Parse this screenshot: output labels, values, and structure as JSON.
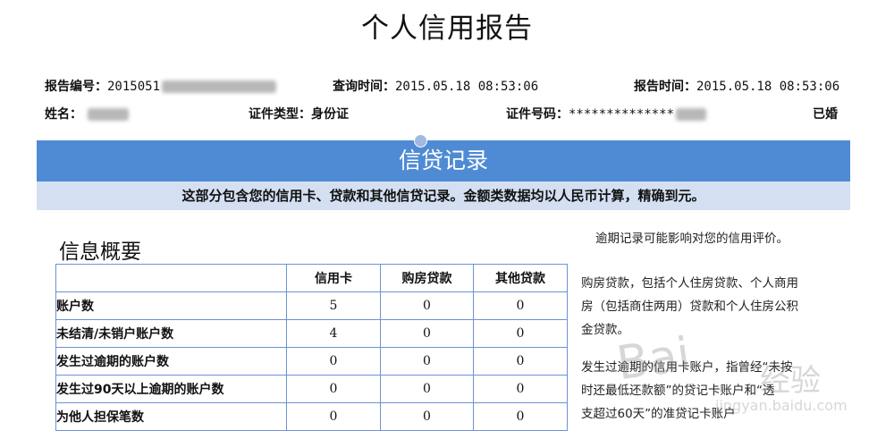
{
  "report": {
    "title": "个人信用报告",
    "report_no_label": "报告编号：",
    "report_no_value": "2015051",
    "query_time_label": "查询时间：",
    "query_time_value": "2015.05.18 08:53:06",
    "report_time_label": "报告时间：",
    "report_time_value": "2015.05.18 08:53:06",
    "name_label": "姓名：",
    "id_type_label": "证件类型：",
    "id_type_value": "身份证",
    "id_no_label": "证件号码：",
    "id_no_value": "**************",
    "marital": "已婚"
  },
  "section": {
    "banner": "信贷记录",
    "subtitle": "这部分包含您的信用卡、贷款和其他信贷记录。金额类数据均以人民币计算，精确到元。"
  },
  "summary": {
    "title": "信息概要",
    "headers": [
      "",
      "信用卡",
      "购房贷款",
      "其他贷款"
    ],
    "rows": [
      {
        "label": "账户数",
        "values": [
          "5",
          "0",
          "0"
        ]
      },
      {
        "label": "未结清/未销户账户数",
        "values": [
          "4",
          "0",
          "0"
        ]
      },
      {
        "label": "发生过逾期的账户数",
        "values": [
          "0",
          "0",
          "0"
        ]
      },
      {
        "label": "发生过90天以上逾期的账户数",
        "values": [
          "0",
          "0",
          "0"
        ]
      },
      {
        "label": "为他人担保笔数",
        "values": [
          "0",
          "0",
          "0"
        ]
      }
    ]
  },
  "notes": {
    "n1": "逾期记录可能影响对您的信用评价。",
    "n2_l1": "购房贷款，包括个人住房贷款、个人商用",
    "n2_l2": "房（包括商住两用）贷款和个人住房公积",
    "n2_l3": "金贷款。",
    "n3_l1": "发生过逾期的信用卡账户，指曾经“未按",
    "n3_l2": "时还最低还款额”的贷记卡账户和“透",
    "n3_l3": "支超过60天”的准贷记卡账户"
  },
  "watermark": {
    "text1": "Bai",
    "text2": "经验",
    "text3": "jingyan.baidu.com"
  }
}
